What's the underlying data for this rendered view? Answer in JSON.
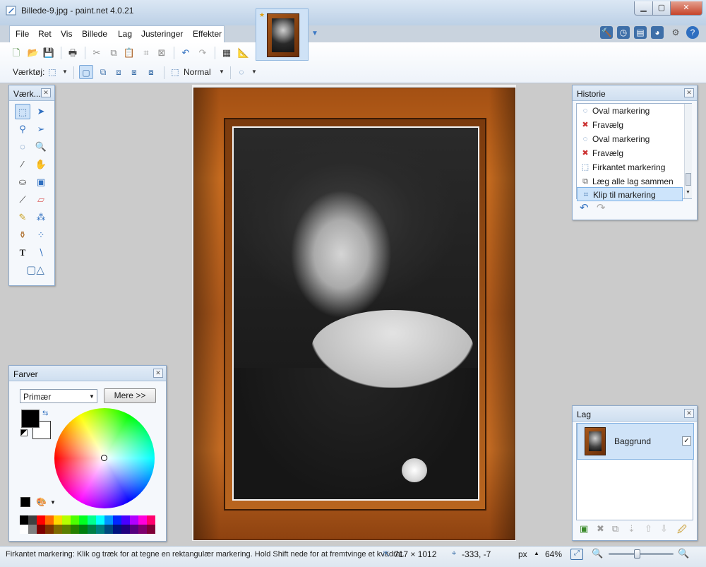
{
  "window": {
    "title": "Billede-9.jpg - paint.net 4.0.21",
    "minimize": "▁",
    "maximize": "▢",
    "close": "✕"
  },
  "menu": [
    "File",
    "Ret",
    "Vis",
    "Billede",
    "Lag",
    "Justeringer",
    "Effekter"
  ],
  "toolbar2": {
    "tool_label": "Værktøj:",
    "blend_mode": "Normal"
  },
  "tools_panel": {
    "title": "Værk..."
  },
  "history_panel": {
    "title": "Historie",
    "items": [
      {
        "label": "Oval markering",
        "icon": "oval-select-icon"
      },
      {
        "label": "Fravælg",
        "icon": "deselect-icon"
      },
      {
        "label": "Oval markering",
        "icon": "oval-select-icon"
      },
      {
        "label": "Fravælg",
        "icon": "deselect-icon"
      },
      {
        "label": "Firkantet markering",
        "icon": "rectangle-select-icon"
      },
      {
        "label": "Læg alle lag sammen",
        "icon": "flatten-icon"
      },
      {
        "label": "Klip til markering",
        "icon": "crop-to-selection-icon"
      }
    ],
    "selected_index": 6
  },
  "colors_panel": {
    "title": "Farver",
    "dropdown": "Primær",
    "more_button": "Mere >>",
    "primary_color": "#000000",
    "secondary_color": "#ffffff"
  },
  "palette": {
    "row1": [
      "#000000",
      "#404040",
      "#ff0000",
      "#ff6a00",
      "#ffd800",
      "#b6ff00",
      "#4cff00",
      "#00ff21",
      "#00ff90",
      "#00ffff",
      "#0094ff",
      "#0026ff",
      "#4800ff",
      "#b200ff",
      "#ff00dc",
      "#ff006e"
    ],
    "row2": [
      "#ffffff",
      "#808080",
      "#7f0000",
      "#7f3300",
      "#7f6a00",
      "#5b7f00",
      "#267f00",
      "#007f0e",
      "#007f46",
      "#007f7f",
      "#004a7f",
      "#00137f",
      "#21007f",
      "#57007f",
      "#7f006e",
      "#7f0037"
    ]
  },
  "layers_panel": {
    "title": "Lag",
    "layers": [
      {
        "name": "Baggrund",
        "visible": true
      }
    ]
  },
  "status": {
    "hint": "Firkantet markering: Klik og træk for at tegne en rektangulær markering. Hold Shift nede for at fremtvinge et kvadrat.",
    "image_size": "717 × 1012",
    "cursor_position": "-333, -7",
    "units": "px",
    "zoom": "64%"
  }
}
